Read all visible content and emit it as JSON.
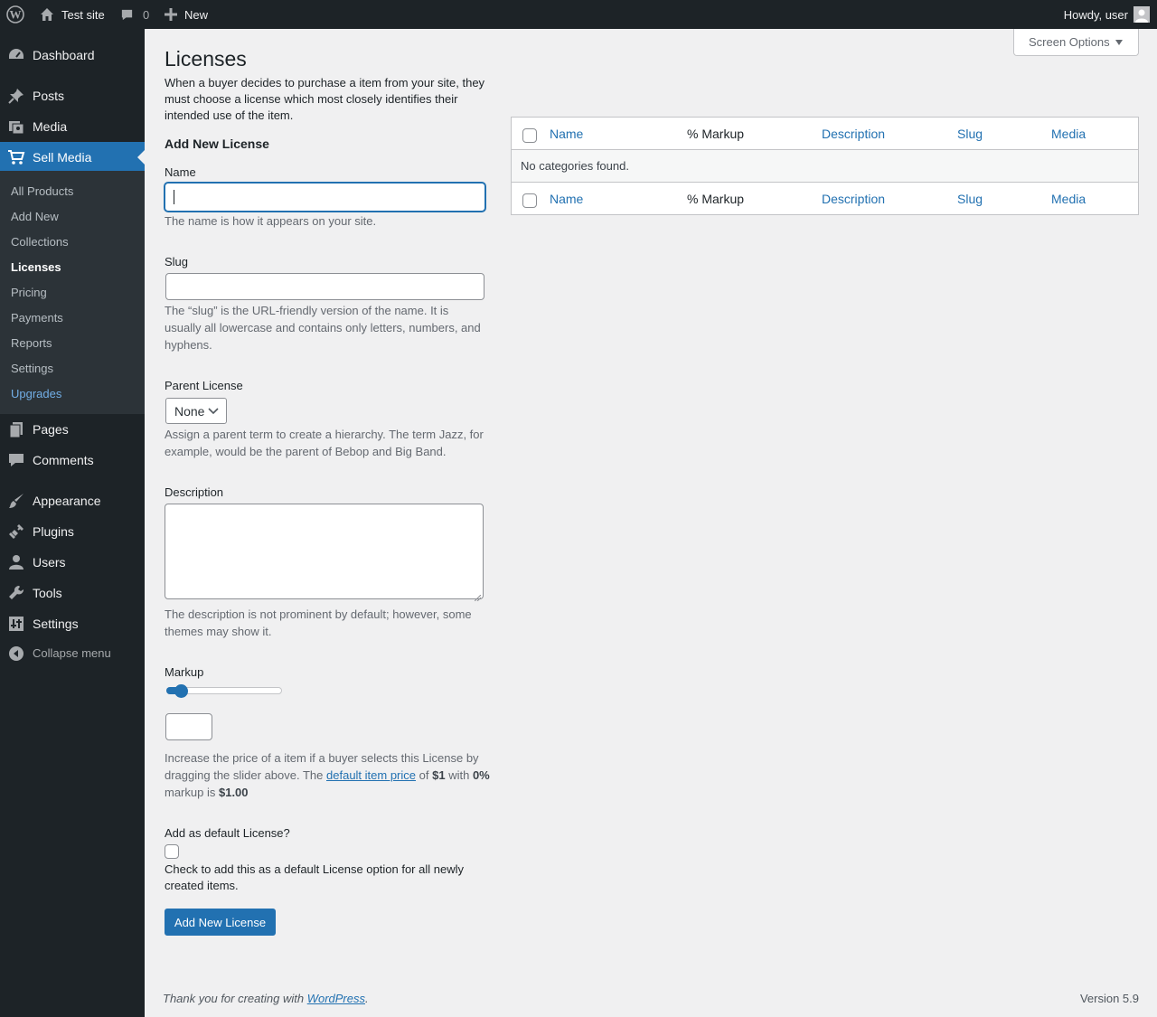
{
  "adminbar": {
    "site_name": "Test site",
    "comments_count": "0",
    "new_label": "New",
    "greeting": "Howdy, user"
  },
  "sidebar": {
    "items": [
      {
        "label": "Dashboard",
        "icon": "dashboard-icon"
      },
      {
        "label": "Posts",
        "icon": "pushpin-icon"
      },
      {
        "label": "Media",
        "icon": "media-icon"
      },
      {
        "label": "Sell Media",
        "icon": "cart-icon"
      },
      {
        "label": "Pages",
        "icon": "pages-icon"
      },
      {
        "label": "Comments",
        "icon": "comment-icon"
      },
      {
        "label": "Appearance",
        "icon": "paintbrush-icon"
      },
      {
        "label": "Plugins",
        "icon": "plugin-icon"
      },
      {
        "label": "Users",
        "icon": "user-icon"
      },
      {
        "label": "Tools",
        "icon": "wrench-icon"
      },
      {
        "label": "Settings",
        "icon": "settings-icon"
      }
    ],
    "submenu": [
      "All Products",
      "Add New",
      "Collections",
      "Licenses",
      "Pricing",
      "Payments",
      "Reports",
      "Settings",
      "Upgrades"
    ],
    "collapse_label": "Collapse menu"
  },
  "screen_options": "Screen Options",
  "page": {
    "title": "Licenses",
    "intro": "When a buyer decides to purchase a item from your site, they must choose a license which most closely identifies their intended use of the item."
  },
  "form": {
    "title": "Add New License",
    "name_label": "Name",
    "name_value": "",
    "name_help": "The name is how it appears on your site.",
    "slug_label": "Slug",
    "slug_value": "",
    "slug_help": "The “slug” is the URL-friendly version of the name. It is usually all lowercase and contains only letters, numbers, and hyphens.",
    "parent_label": "Parent License",
    "parent_value": "None",
    "parent_help": "Assign a parent term to create a hierarchy. The term Jazz, for example, would be the parent of Bebop and Big Band.",
    "description_label": "Description",
    "description_value": "",
    "description_help": "The description is not prominent by default; however, some themes may show it.",
    "markup_label": "Markup",
    "markup_slider_value": 0,
    "markup_value": "",
    "markup_help_1": "Increase the price of a item if a buyer selects this License by dragging the slider above. The",
    "markup_help_link": "default item price",
    "markup_help_2": "of",
    "markup_help_price": "$1",
    "markup_help_3": "with",
    "markup_help_percent": "0%",
    "markup_help_4": "markup is",
    "markup_help_total": "$1.00",
    "default_label": "Add as default License?",
    "default_checked": false,
    "default_help": "Check to add this as a default License option for all newly created items.",
    "submit_label": "Add New License"
  },
  "table": {
    "columns": [
      "Name",
      "% Markup",
      "Description",
      "Slug",
      "Media"
    ],
    "empty_message": "No categories found."
  },
  "footer": {
    "thanks_prefix": "Thank you for creating with",
    "thanks_link": "WordPress",
    "thanks_suffix": ".",
    "version": "Version 5.9"
  },
  "colors": {
    "accent": "#2271b1",
    "sidebar_bg": "#1d2327",
    "submenu_bg": "#2c3338",
    "page_bg": "#f0f0f1"
  }
}
